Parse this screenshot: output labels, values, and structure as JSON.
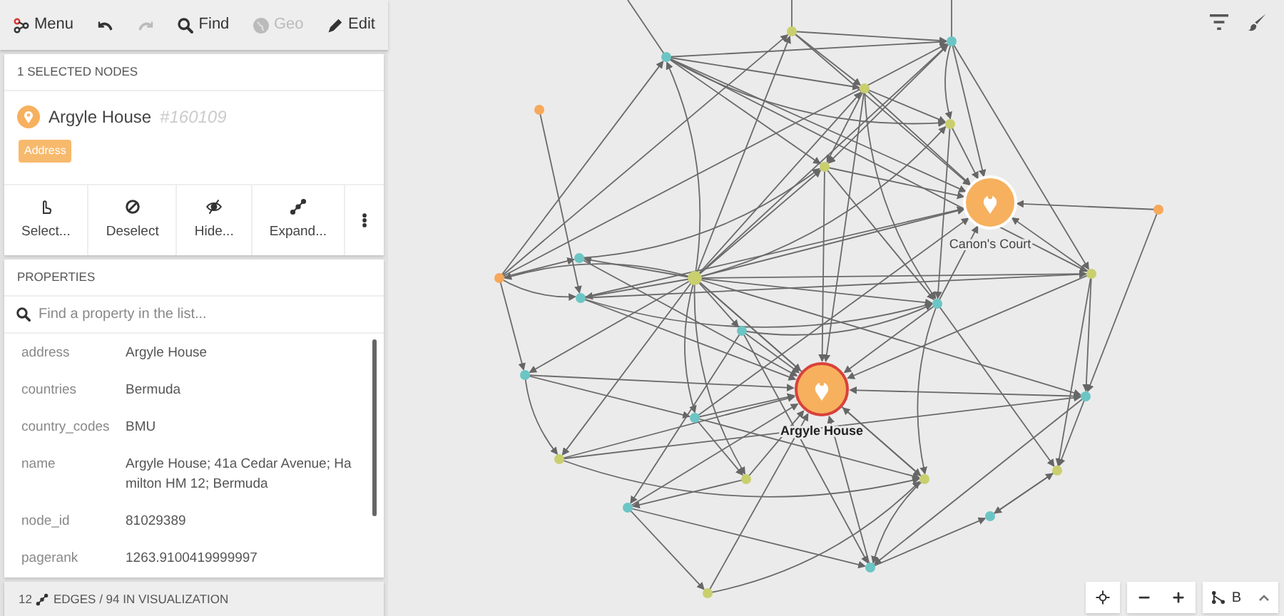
{
  "toolbar": [
    {
      "kind": "menu",
      "label": "Menu",
      "disabled": false
    },
    {
      "kind": "undo",
      "disabled": false
    },
    {
      "kind": "redo",
      "disabled": true
    },
    {
      "kind": "search",
      "label": "Find",
      "disabled": false
    },
    {
      "kind": "globe",
      "label": "Geo",
      "disabled": true
    },
    {
      "kind": "pencil",
      "label": "Edit",
      "disabled": false
    }
  ],
  "selection": {
    "title": "1 SELECTED NODES",
    "node": {
      "name": "Argyle House",
      "id": "#160109",
      "category": "Address"
    },
    "actions": [
      {
        "kind": "hand",
        "label": "Select..."
      },
      {
        "kind": "ban",
        "label": "Deselect"
      },
      {
        "kind": "eye",
        "label": "Hide..."
      },
      {
        "kind": "expand",
        "label": "Expand..."
      },
      {
        "kind": "more"
      }
    ]
  },
  "properties": {
    "title": "PROPERTIES",
    "search": {
      "placeholder": "Find a property in the list..."
    },
    "rows": [
      {
        "key": "address",
        "value": "Argyle House"
      },
      {
        "key": "countries",
        "value": "Bermuda"
      },
      {
        "key": "country_codes",
        "value": "BMU"
      },
      {
        "key": "name",
        "value": "Argyle House; 41a Cedar Avenue; Ha milton HM 12; Bermuda"
      },
      {
        "key": "node_id",
        "value": "81029389"
      },
      {
        "key": "pagerank",
        "value": "1263.9100419999997"
      }
    ]
  },
  "footer": {
    "count": "12",
    "text": "EDGES / 94 IN VISUALIZATION"
  },
  "graph": {
    "nodes": [
      {
        "label": "Argyle House",
        "selected": true
      },
      {
        "label": "Canon's Court",
        "selected": false
      }
    ]
  },
  "zoom_controls": [
    {
      "kind": "locate"
    },
    {
      "kind": "minus"
    },
    {
      "kind": "plus"
    }
  ],
  "layout_button": {
    "label": "B"
  }
}
